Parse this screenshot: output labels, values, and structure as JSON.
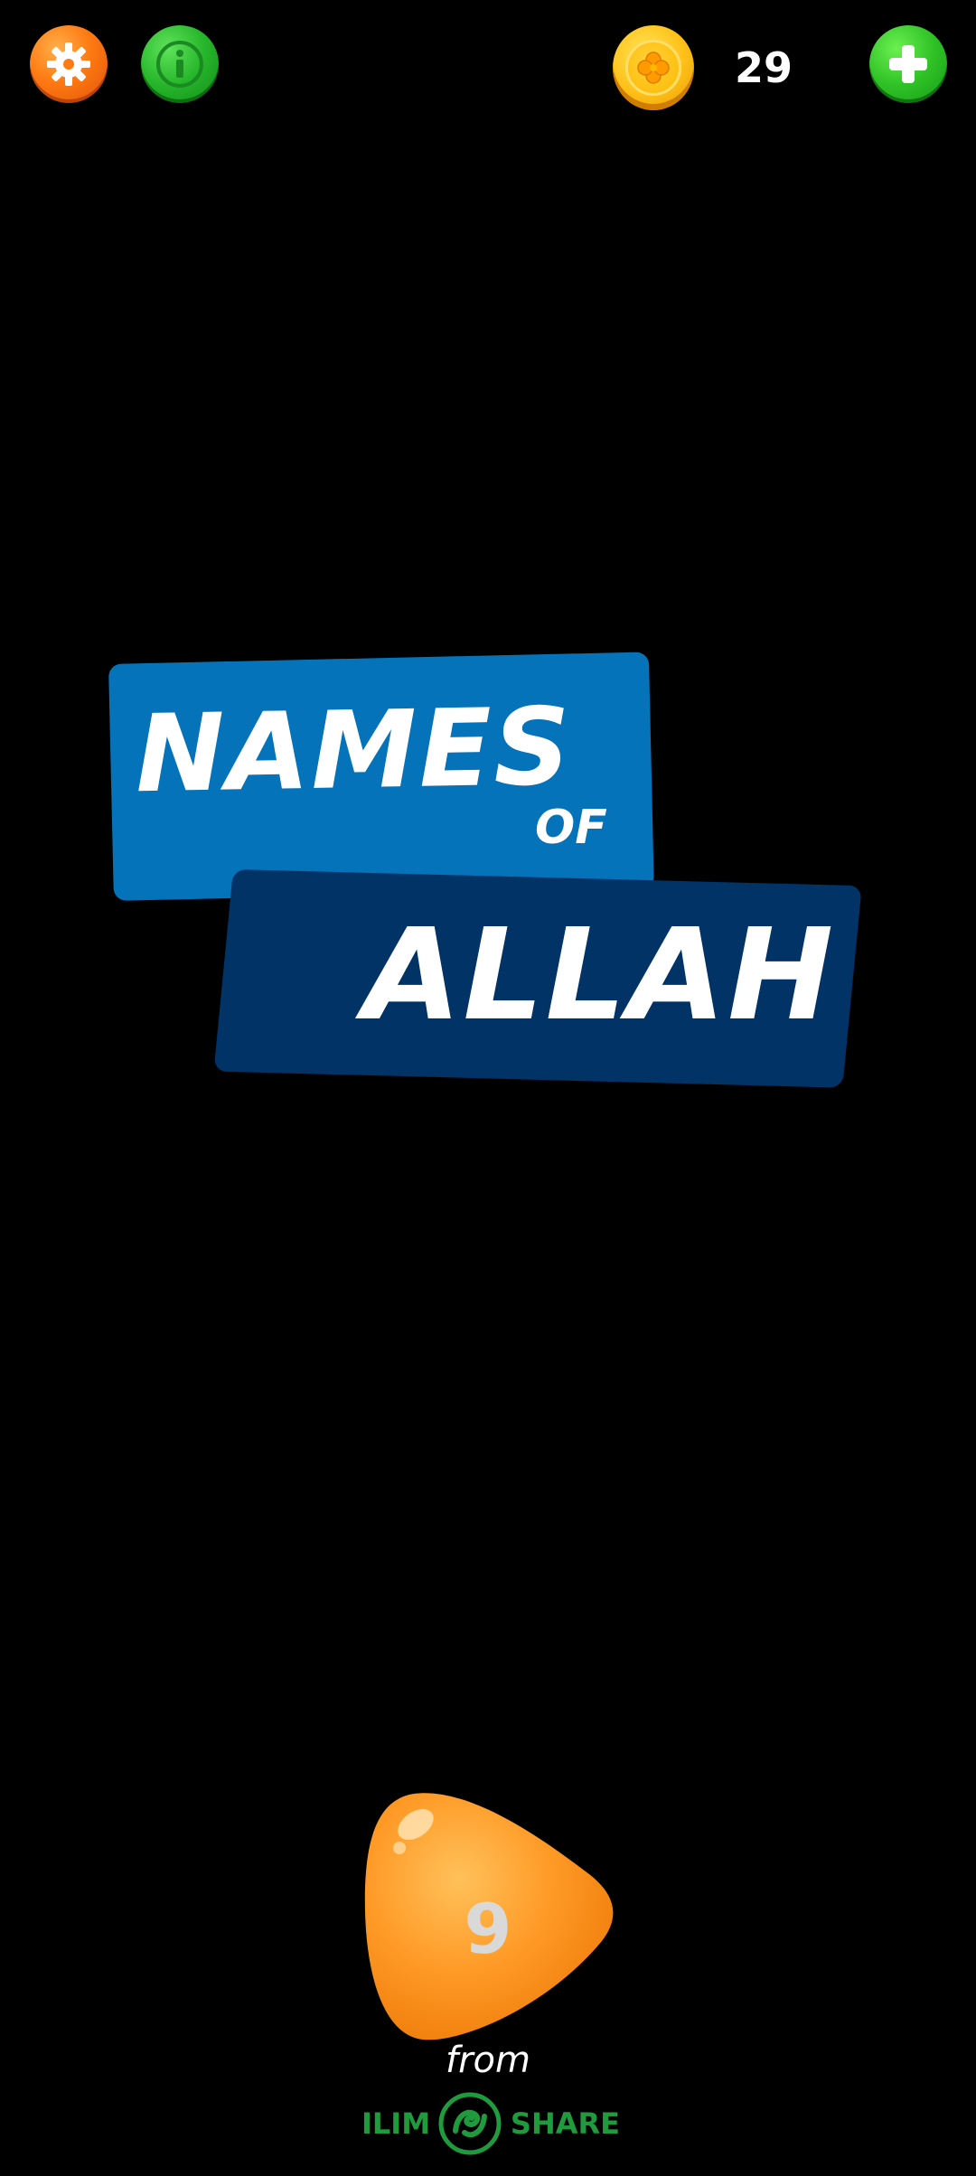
{
  "header": {
    "coins": "29",
    "icons": {
      "settings": "gear-icon",
      "info": "info-icon",
      "coin": "clover-coin-icon",
      "add": "plus-icon"
    }
  },
  "logo": {
    "line1": "NAMES",
    "line2": "OF",
    "line3": "ALLAH",
    "colors": {
      "top_panel": "#0473b9",
      "bottom_panel": "#013366",
      "text": "#ffffff"
    }
  },
  "play": {
    "level": "9",
    "color": "#ff9a26"
  },
  "footer": {
    "from": "from",
    "brand_left": "ILIM",
    "brand_right": "SHARE",
    "brand_color": "#1f9a3c"
  }
}
